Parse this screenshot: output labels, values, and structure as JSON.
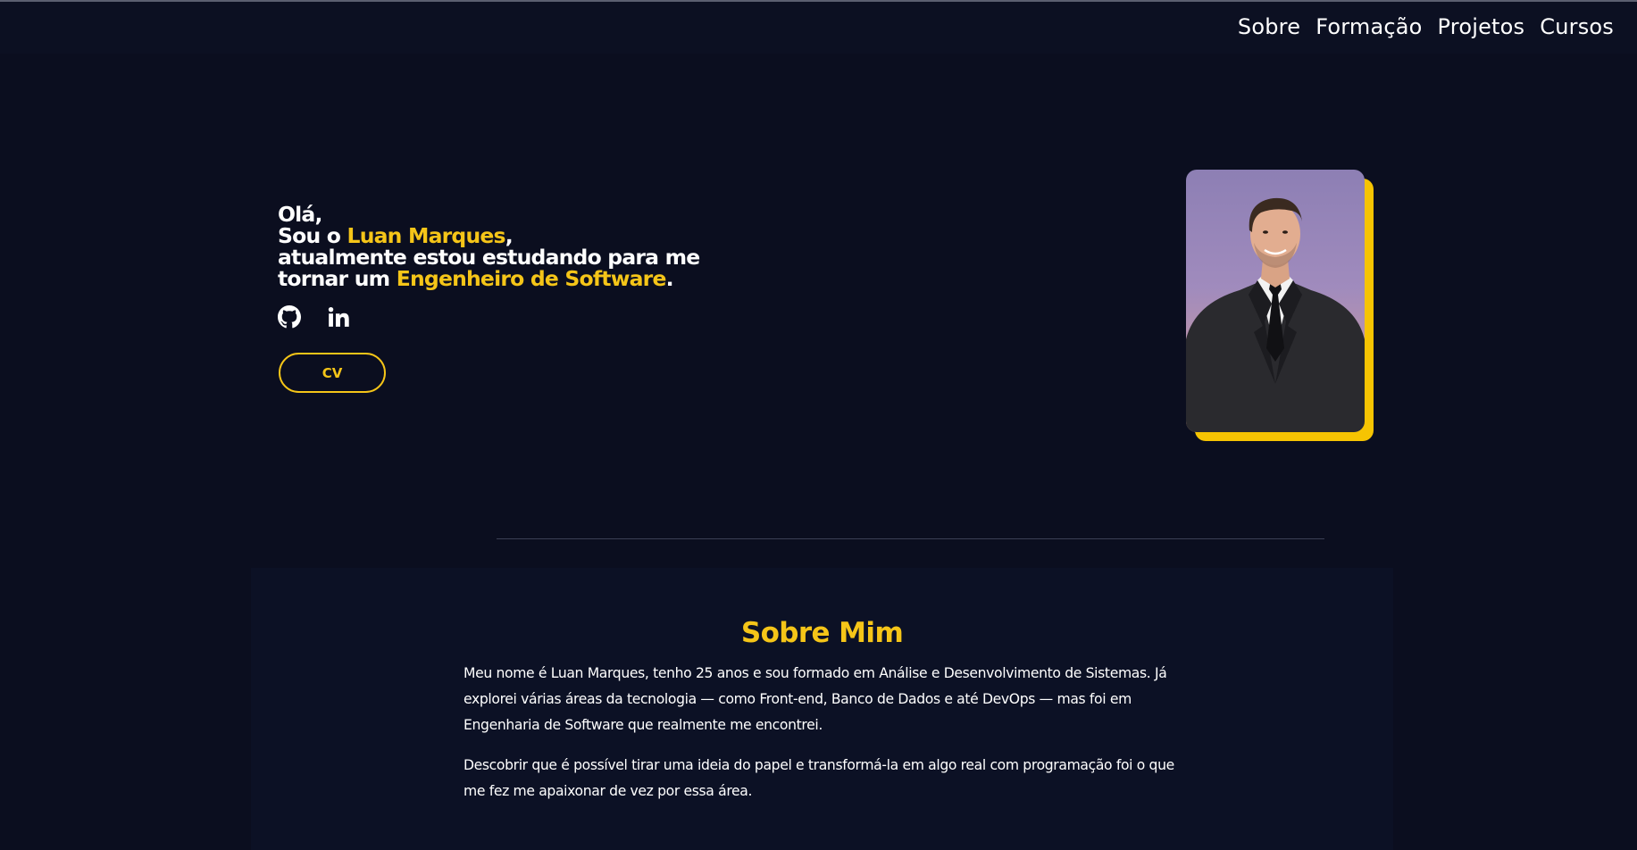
{
  "nav": {
    "links": [
      "Sobre",
      "Formação",
      "Projetos",
      "Cursos"
    ]
  },
  "hero": {
    "greeting": "Olá,",
    "intro_prefix": "Sou o ",
    "name": "Luan Marques",
    "intro_suffix": ",",
    "line3": "atualmente estou estudando para me",
    "line4_prefix": "tornar um ",
    "role": "Engenheiro de Software",
    "line4_suffix": ".",
    "social_icons": [
      "github-icon",
      "linkedin-icon"
    ],
    "cv_label": "CV",
    "photo_icon": "profile-photo"
  },
  "about": {
    "title": "Sobre Mim",
    "paragraphs": [
      "Meu nome é Luan Marques, tenho 25 anos e sou formado em Análise e Desenvolvimento de Sistemas. Já explorei várias áreas da tecnologia — como Front-end, Banco de Dados e até DevOps — mas foi em Engenharia de Software que realmente me encontrei.",
      "Descobrir que é possível tirar uma ideia do papel e transformá-la em algo real com programação foi o que me fez me apaixonar de vez por essa área."
    ]
  },
  "colors": {
    "background": "#0b0e1f",
    "accent": "#f5c518",
    "text": "#ffffff"
  }
}
